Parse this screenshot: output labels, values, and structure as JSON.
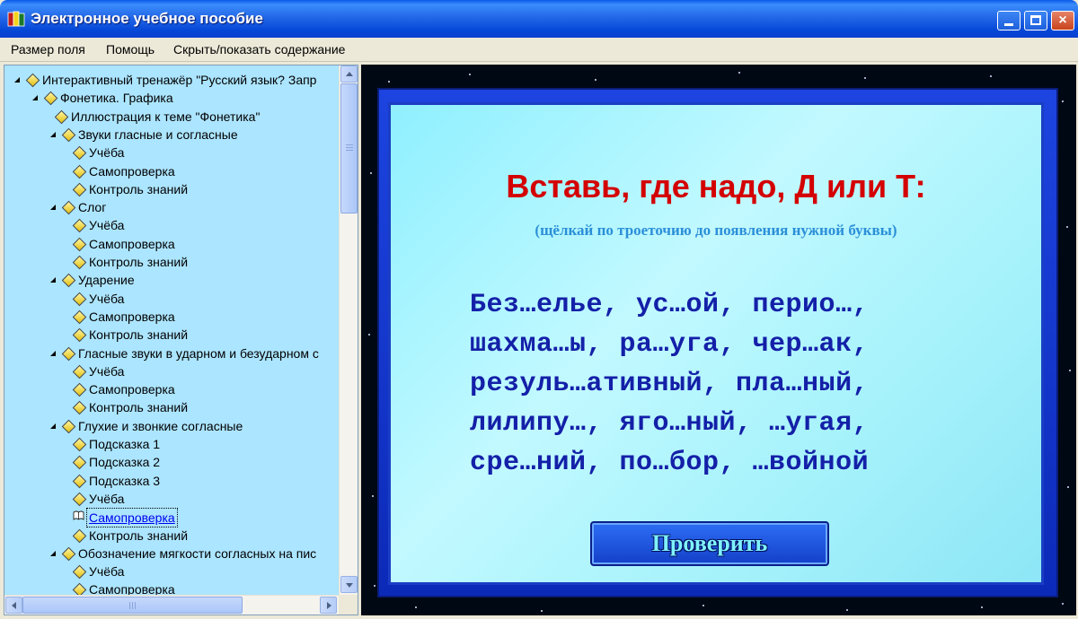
{
  "window": {
    "title": "Электронное учебное пособие",
    "close_glyph": "×"
  },
  "menu": {
    "items": [
      "Размер поля",
      "Помощь",
      "Скрыть/показать содержание"
    ]
  },
  "tree": {
    "items": [
      {
        "label": "Интерактивный тренажёр \"Русский язык? Запр",
        "level": 0,
        "expandable": true
      },
      {
        "label": "Фонетика. Графика",
        "level": 1,
        "expandable": true
      },
      {
        "label": "Иллюстрация к теме \"Фонетика\"",
        "level": 2,
        "expandable": false
      },
      {
        "label": "Звуки гласные и согласные",
        "level": 2,
        "expandable": true
      },
      {
        "label": "Учёба",
        "level": 3,
        "expandable": false
      },
      {
        "label": "Самопроверка",
        "level": 3,
        "expandable": false
      },
      {
        "label": "Контроль знаний",
        "level": 3,
        "expandable": false
      },
      {
        "label": "Слог",
        "level": 2,
        "expandable": true
      },
      {
        "label": "Учёба",
        "level": 3,
        "expandable": false
      },
      {
        "label": "Самопроверка",
        "level": 3,
        "expandable": false
      },
      {
        "label": "Контроль знаний",
        "level": 3,
        "expandable": false
      },
      {
        "label": "Ударение",
        "level": 2,
        "expandable": true
      },
      {
        "label": "Учёба",
        "level": 3,
        "expandable": false
      },
      {
        "label": "Самопроверка",
        "level": 3,
        "expandable": false
      },
      {
        "label": "Контроль знаний",
        "level": 3,
        "expandable": false
      },
      {
        "label": "Гласные звуки в ударном и безударном с",
        "level": 2,
        "expandable": true
      },
      {
        "label": "Учёба",
        "level": 3,
        "expandable": false
      },
      {
        "label": "Самопроверка",
        "level": 3,
        "expandable": false
      },
      {
        "label": "Контроль знаний",
        "level": 3,
        "expandable": false
      },
      {
        "label": "Глухие и звонкие согласные",
        "level": 2,
        "expandable": true
      },
      {
        "label": "Подсказка 1",
        "level": 3,
        "expandable": false
      },
      {
        "label": "Подсказка 2",
        "level": 3,
        "expandable": false
      },
      {
        "label": "Подсказка 3",
        "level": 3,
        "expandable": false
      },
      {
        "label": "Учёба",
        "level": 3,
        "expandable": false
      },
      {
        "label": "Самопроверка",
        "level": 3,
        "expandable": false,
        "selected": true
      },
      {
        "label": "Контроль знаний",
        "level": 3,
        "expandable": false
      },
      {
        "label": "Обозначение мягкости согласных на пис",
        "level": 2,
        "expandable": true
      },
      {
        "label": "Учёба",
        "level": 3,
        "expandable": false
      },
      {
        "label": "Самопроверка",
        "level": 3,
        "expandable": false
      }
    ]
  },
  "exercise": {
    "title": "Вставь, где надо, Д или Т:",
    "hint": "(щёлкай по троеточию до появления нужной буквы)",
    "lines": [
      "Без…елье, ус…ой, перио…,",
      "шахма…ы, ра…уга, чер…ак,",
      "резуль…ативный, пла…ный,",
      "лилипу…, яго…ный, …угая,",
      "сре…ний, по…бор, …войной"
    ],
    "check_label": "Проверить"
  },
  "colors": {
    "title_red": "#d40000",
    "hint_blue": "#2b8fd8",
    "words_navy": "#1420a8",
    "tree_bg": "#ace5ff"
  }
}
